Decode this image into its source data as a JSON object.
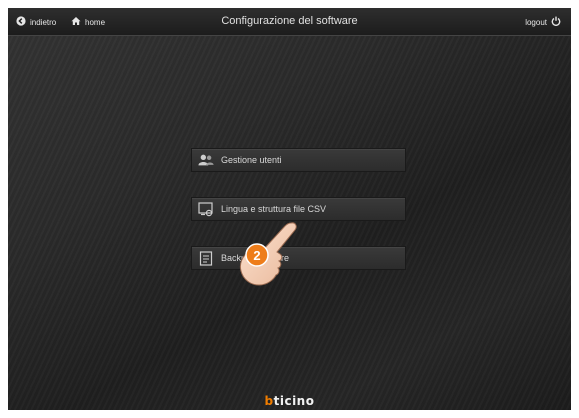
{
  "header": {
    "back_label": "indietro",
    "home_label": "home",
    "title": "Configurazione del software",
    "logout_label": "logout"
  },
  "menu": [
    {
      "label": "Gestione utenti",
      "icon": "users-icon"
    },
    {
      "label": "Lingua e struttura file CSV",
      "icon": "csv-settings-icon"
    },
    {
      "label": "Backup e restore",
      "icon": "backup-icon"
    }
  ],
  "annotation": {
    "step": "2"
  },
  "footer": {
    "brand_b": "b",
    "brand_rest": "ticino"
  },
  "colors": {
    "accent": "#f07d00",
    "background": "#262626",
    "text": "#e0e0e0"
  }
}
